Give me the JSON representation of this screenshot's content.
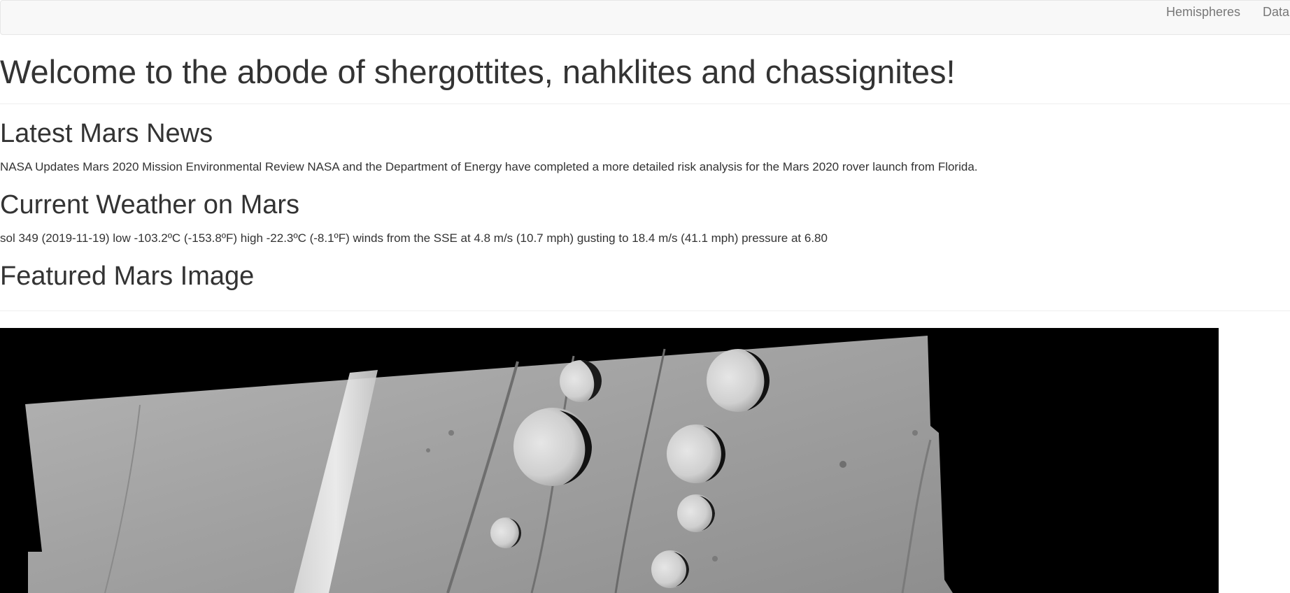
{
  "navbar": {
    "links": [
      {
        "label": "Hemispheres"
      },
      {
        "label": "Data"
      }
    ]
  },
  "header": {
    "title": "Welcome to the abode of shergottites, nahklites and chassignites!"
  },
  "news": {
    "heading": "Latest Mars News",
    "text": "NASA Updates Mars 2020 Mission Environmental Review NASA and the Department of Energy have completed a more detailed risk analysis for the Mars 2020 rover launch from Florida."
  },
  "weather": {
    "heading": "Current Weather on Mars",
    "text": "sol 349 (2019-11-19) low -103.2ºC (-153.8ºF) high -22.3ºC (-8.1ºF) winds from the SSE at 4.8 m/s (10.7 mph) gusting to 18.4 m/s (41.1 mph) pressure at 6.80"
  },
  "featured_image": {
    "heading": "Featured Mars Image"
  }
}
